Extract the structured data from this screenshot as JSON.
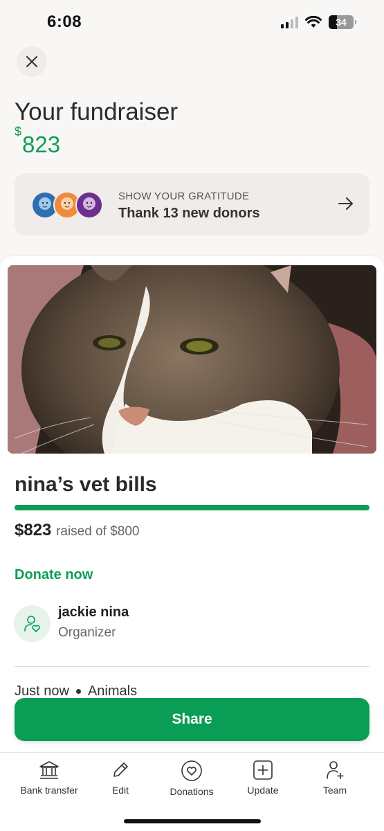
{
  "status_bar": {
    "time": "6:08",
    "battery": "34"
  },
  "header": {
    "title": "Your fundraiser",
    "amount_currency": "$",
    "amount_value": "823"
  },
  "gratitude_card": {
    "kicker": "SHOW YOUR GRATITUDE",
    "text": "Thank 13 new donors"
  },
  "fundraiser": {
    "title": "nina’s vet bills",
    "raised_amount": "$823",
    "raised_of": "raised of $800",
    "progress_fraction": 1.0,
    "donate_label": "Donate now",
    "organizer_name": "jackie nina",
    "organizer_role": "Organizer",
    "posted": "Just now",
    "category": "Animals"
  },
  "share_button": {
    "label": "Share"
  },
  "tab_bar": {
    "items": [
      {
        "label": "Bank transfer",
        "icon": "bank-icon"
      },
      {
        "label": "Edit",
        "icon": "pencil-icon"
      },
      {
        "label": "Donations",
        "icon": "heart-circle-icon"
      },
      {
        "label": "Update",
        "icon": "plus-square-icon"
      },
      {
        "label": "Team",
        "icon": "add-person-icon"
      }
    ]
  },
  "colors": {
    "brand_green": "#0a9d55",
    "background": "#f9f7f5",
    "card": "#efece9"
  }
}
